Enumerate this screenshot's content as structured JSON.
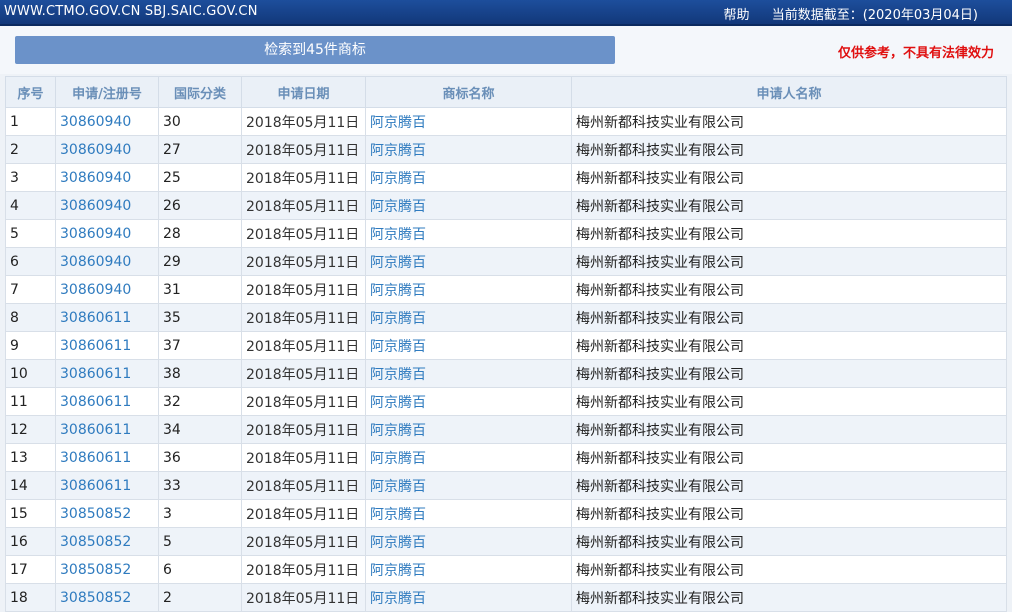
{
  "header": {
    "sites": "WWW.CTMO.GOV.CN SBJ.SAIC.GOV.CN",
    "help": "帮助",
    "data_as_of": "当前数据截至：(2020年03月04日)"
  },
  "summary": {
    "result_label": "检索到45件商标",
    "disclaimer": "仅供参考，不具有法律效力"
  },
  "table": {
    "columns": [
      "序号",
      "申请/注册号",
      "国际分类",
      "申请日期",
      "商标名称",
      "申请人名称"
    ],
    "rows": [
      {
        "no": "1",
        "reg": "30860940",
        "cls": "30",
        "date": "2018年05月11日",
        "name": "阿京腾百",
        "applicant": "梅州新都科技实业有限公司"
      },
      {
        "no": "2",
        "reg": "30860940",
        "cls": "27",
        "date": "2018年05月11日",
        "name": "阿京腾百",
        "applicant": "梅州新都科技实业有限公司"
      },
      {
        "no": "3",
        "reg": "30860940",
        "cls": "25",
        "date": "2018年05月11日",
        "name": "阿京腾百",
        "applicant": "梅州新都科技实业有限公司"
      },
      {
        "no": "4",
        "reg": "30860940",
        "cls": "26",
        "date": "2018年05月11日",
        "name": "阿京腾百",
        "applicant": "梅州新都科技实业有限公司"
      },
      {
        "no": "5",
        "reg": "30860940",
        "cls": "28",
        "date": "2018年05月11日",
        "name": "阿京腾百",
        "applicant": "梅州新都科技实业有限公司"
      },
      {
        "no": "6",
        "reg": "30860940",
        "cls": "29",
        "date": "2018年05月11日",
        "name": "阿京腾百",
        "applicant": "梅州新都科技实业有限公司"
      },
      {
        "no": "7",
        "reg": "30860940",
        "cls": "31",
        "date": "2018年05月11日",
        "name": "阿京腾百",
        "applicant": "梅州新都科技实业有限公司"
      },
      {
        "no": "8",
        "reg": "30860611",
        "cls": "35",
        "date": "2018年05月11日",
        "name": "阿京腾百",
        "applicant": "梅州新都科技实业有限公司"
      },
      {
        "no": "9",
        "reg": "30860611",
        "cls": "37",
        "date": "2018年05月11日",
        "name": "阿京腾百",
        "applicant": "梅州新都科技实业有限公司"
      },
      {
        "no": "10",
        "reg": "30860611",
        "cls": "38",
        "date": "2018年05月11日",
        "name": "阿京腾百",
        "applicant": "梅州新都科技实业有限公司"
      },
      {
        "no": "11",
        "reg": "30860611",
        "cls": "32",
        "date": "2018年05月11日",
        "name": "阿京腾百",
        "applicant": "梅州新都科技实业有限公司"
      },
      {
        "no": "12",
        "reg": "30860611",
        "cls": "34",
        "date": "2018年05月11日",
        "name": "阿京腾百",
        "applicant": "梅州新都科技实业有限公司"
      },
      {
        "no": "13",
        "reg": "30860611",
        "cls": "36",
        "date": "2018年05月11日",
        "name": "阿京腾百",
        "applicant": "梅州新都科技实业有限公司"
      },
      {
        "no": "14",
        "reg": "30860611",
        "cls": "33",
        "date": "2018年05月11日",
        "name": "阿京腾百",
        "applicant": "梅州新都科技实业有限公司"
      },
      {
        "no": "15",
        "reg": "30850852",
        "cls": "3",
        "date": "2018年05月11日",
        "name": "阿京腾百",
        "applicant": "梅州新都科技实业有限公司"
      },
      {
        "no": "16",
        "reg": "30850852",
        "cls": "5",
        "date": "2018年05月11日",
        "name": "阿京腾百",
        "applicant": "梅州新都科技实业有限公司"
      },
      {
        "no": "17",
        "reg": "30850852",
        "cls": "6",
        "date": "2018年05月11日",
        "name": "阿京腾百",
        "applicant": "梅州新都科技实业有限公司"
      },
      {
        "no": "18",
        "reg": "30850852",
        "cls": "2",
        "date": "2018年05月11日",
        "name": "阿京腾百",
        "applicant": "梅州新都科技实业有限公司"
      }
    ]
  }
}
